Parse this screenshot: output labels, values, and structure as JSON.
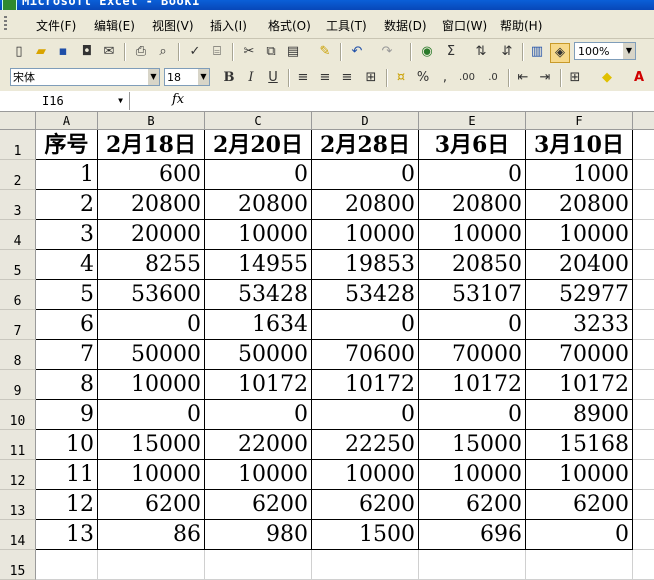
{
  "window": {
    "title": "Microsoft Excel - Book1"
  },
  "menu": [
    "文件(F)",
    "编辑(E)",
    "视图(V)",
    "插入(I)",
    "格式(O)",
    "工具(T)",
    "数据(D)",
    "窗口(W)",
    "帮助(H)"
  ],
  "toolbar": {
    "zoom": "100%",
    "font_name": "宋体",
    "font_size": "18"
  },
  "formula_bar": {
    "name_box": "I16",
    "fx_label": "fx",
    "content": ""
  },
  "columns": [
    "A",
    "B",
    "C",
    "D",
    "E",
    "F"
  ],
  "rows": [
    "1",
    "2",
    "3",
    "4",
    "5",
    "6",
    "7",
    "8",
    "9",
    "10",
    "11",
    "12",
    "13",
    "14",
    "15"
  ],
  "sheet": {
    "header": [
      "序号",
      "2月18日",
      "2月20日",
      "2月28日",
      "3月6日",
      "3月10日"
    ],
    "data": [
      [
        "1",
        "600",
        "0",
        "0",
        "0",
        "1000"
      ],
      [
        "2",
        "20800",
        "20800",
        "20800",
        "20800",
        "20800"
      ],
      [
        "3",
        "20000",
        "10000",
        "10000",
        "10000",
        "10000"
      ],
      [
        "4",
        "8255",
        "14955",
        "19853",
        "20850",
        "20400"
      ],
      [
        "5",
        "53600",
        "53428",
        "53428",
        "53107",
        "52977"
      ],
      [
        "6",
        "0",
        "1634",
        "0",
        "0",
        "3233"
      ],
      [
        "7",
        "50000",
        "50000",
        "70600",
        "70000",
        "70000"
      ],
      [
        "8",
        "10000",
        "10172",
        "10172",
        "10172",
        "10172"
      ],
      [
        "9",
        "0",
        "0",
        "0",
        "0",
        "8900"
      ],
      [
        "10",
        "15000",
        "22000",
        "22250",
        "15000",
        "15168"
      ],
      [
        "11",
        "10000",
        "10000",
        "10000",
        "10000",
        "10000"
      ],
      [
        "12",
        "6200",
        "6200",
        "6200",
        "6200",
        "6200"
      ],
      [
        "13",
        "86",
        "980",
        "1500",
        "696",
        "0"
      ]
    ]
  }
}
